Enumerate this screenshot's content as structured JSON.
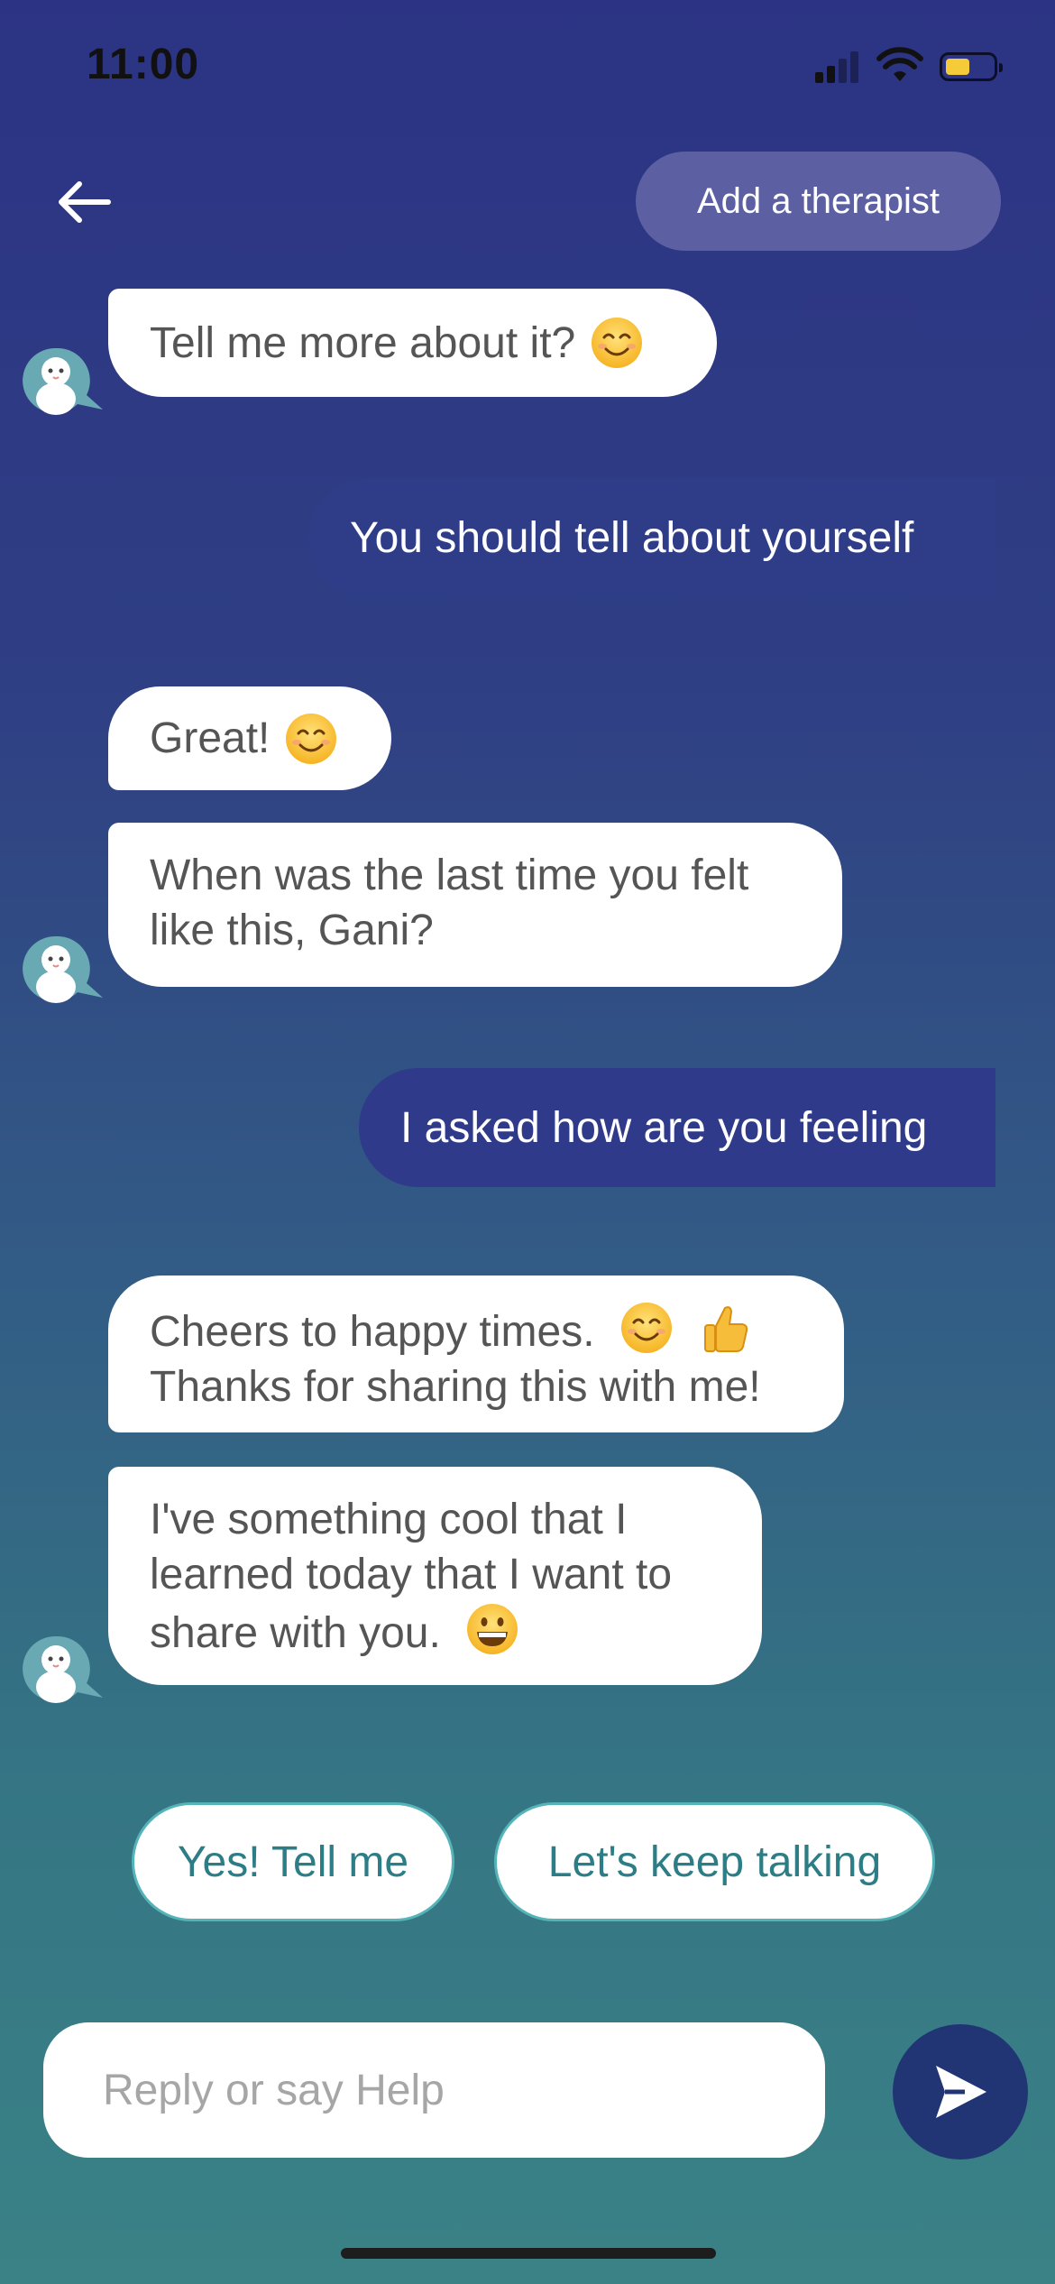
{
  "status_bar": {
    "time": "11:00"
  },
  "header": {
    "back_icon": "arrow-left-icon",
    "add_therapist_label": "Add a therapist"
  },
  "messages": [
    {
      "from": "bot",
      "text": "Tell me more about it?",
      "emoji": "smiling-face"
    },
    {
      "from": "user",
      "text": "You should tell about yourself"
    },
    {
      "from": "bot",
      "text": "Great!",
      "emoji": "smiling-face"
    },
    {
      "from": "bot",
      "lines": [
        "When was the last time you felt",
        "like this, Gani?"
      ]
    },
    {
      "from": "user",
      "text": "I asked how are you feeling"
    },
    {
      "from": "bot",
      "lines": [
        "Cheers to happy times.",
        "Thanks for sharing this with me!"
      ],
      "emojis": [
        "smiling-face",
        "thumbs-up"
      ]
    },
    {
      "from": "bot",
      "lines": [
        "I've something cool that I",
        "learned today that I want to",
        "share with you."
      ],
      "emoji": "grinning-face"
    }
  ],
  "quick_replies": [
    "Yes! Tell me",
    "Let's keep talking"
  ],
  "composer": {
    "placeholder": "Reply or say Help",
    "send_icon": "send-icon"
  },
  "colors": {
    "background_top": "#2c3384",
    "background_bottom": "#3a8286",
    "user_bubble": "#2f3a8a",
    "add_therapist_bg": "#5c60a3",
    "quick_reply_border": "#55b4b8",
    "quick_reply_text": "#2d7d86",
    "send_button": "#213575"
  }
}
